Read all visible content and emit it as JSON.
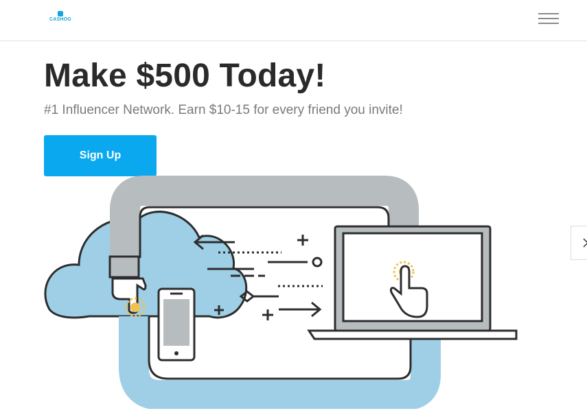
{
  "header": {
    "logo_text": "CASHOG",
    "menu_icon": "hamburger-menu-icon"
  },
  "hero": {
    "title": "Make $500 Today!",
    "subtitle": "#1 Influencer Network. Earn $10-15 for every friend you invite!",
    "cta_label": "Sign Up"
  },
  "illustration": {
    "name": "cloud-sync-illustration",
    "icons": [
      "cloud-icon",
      "hand-pointer-icon",
      "smartphone-icon",
      "laptop-icon",
      "arrow-left-icon",
      "arrow-right-icon",
      "plus-icon",
      "diamond-icon",
      "circle-icon"
    ]
  },
  "carousel": {
    "next_icon": "chevron-right-icon"
  },
  "colors": {
    "brand": "#17a3db",
    "button": "#0aa9ef",
    "title": "#2a2a2a",
    "subtitle": "#7a7a7a",
    "cloud": "#9ecfe6",
    "pipe": "#b7bcbf",
    "sparkle": "#f2c14e"
  }
}
